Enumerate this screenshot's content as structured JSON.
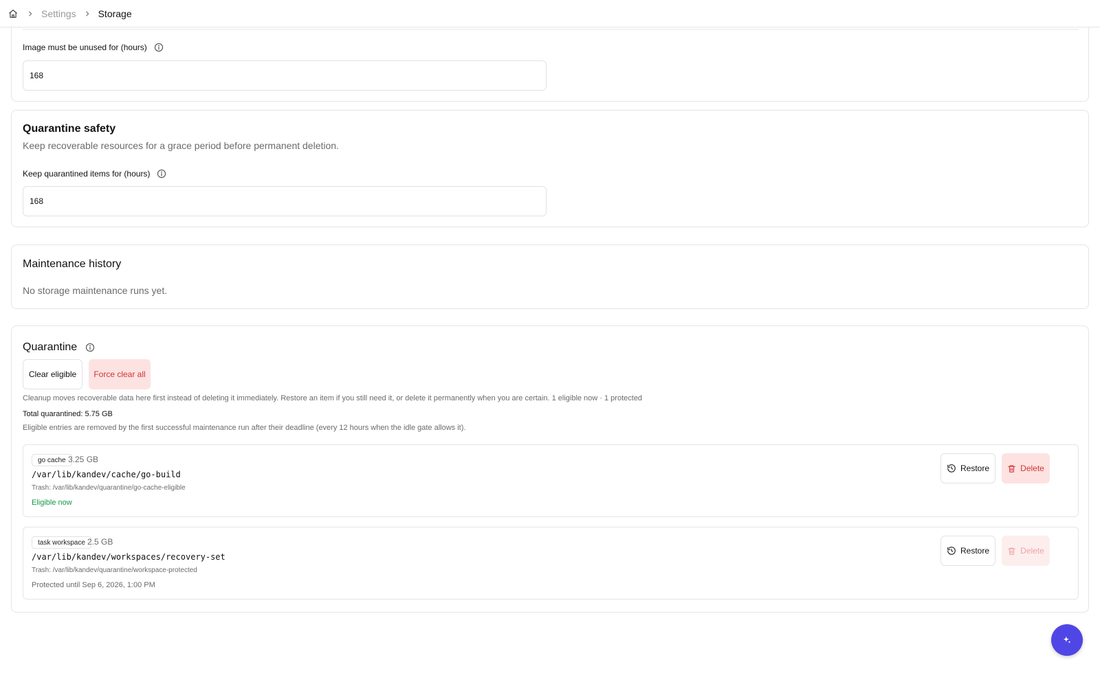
{
  "breadcrumb": {
    "home_icon": "home-icon",
    "items": [
      {
        "label": "Settings"
      },
      {
        "label": "Storage"
      }
    ]
  },
  "image_cleanup": {
    "unused_hours_label": "Image must be unused for (hours)",
    "unused_hours_value": "168"
  },
  "quarantine_safety": {
    "title": "Quarantine safety",
    "description": "Keep recoverable resources for a grace period before permanent deletion.",
    "keep_hours_label": "Keep quarantined items for (hours)",
    "keep_hours_value": "168"
  },
  "maintenance_history": {
    "title": "Maintenance history",
    "empty_text": "No storage maintenance runs yet."
  },
  "quarantine": {
    "title": "Quarantine",
    "clear_eligible_label": "Clear eligible",
    "force_clear_label": "Force clear all",
    "description": "Cleanup moves recoverable data here first instead of deleting it immediately. Restore an item if you still need it, or delete it permanently when you are certain. 1 eligible now · 1 protected",
    "total_label": "Total quarantined: 5.75 GB",
    "eligibility_note": "Eligible entries are removed by the first successful maintenance run after their deadline (every 12 hours when the idle gate allows it).",
    "items": [
      {
        "kind": "go cache",
        "size": "3.25 GB",
        "path": "/var/lib/kandev/cache/go-build",
        "trash": "Trash: /var/lib/kandev/quarantine/go-cache-eligible",
        "status": "Eligible now",
        "restore_label": "Restore",
        "delete_label": "Delete",
        "delete_enabled": true
      },
      {
        "kind": "task workspace",
        "size": "2.5 GB",
        "path": "/var/lib/kandev/workspaces/recovery-set",
        "trash": "Trash: /var/lib/kandev/quarantine/workspace-protected",
        "status": "Protected until Sep 6, 2026, 1:00 PM",
        "restore_label": "Restore",
        "delete_label": "Delete",
        "delete_enabled": false
      }
    ]
  },
  "colors": {
    "accent": "#4f46e5",
    "danger": "#d13434",
    "success": "#119a4c"
  }
}
